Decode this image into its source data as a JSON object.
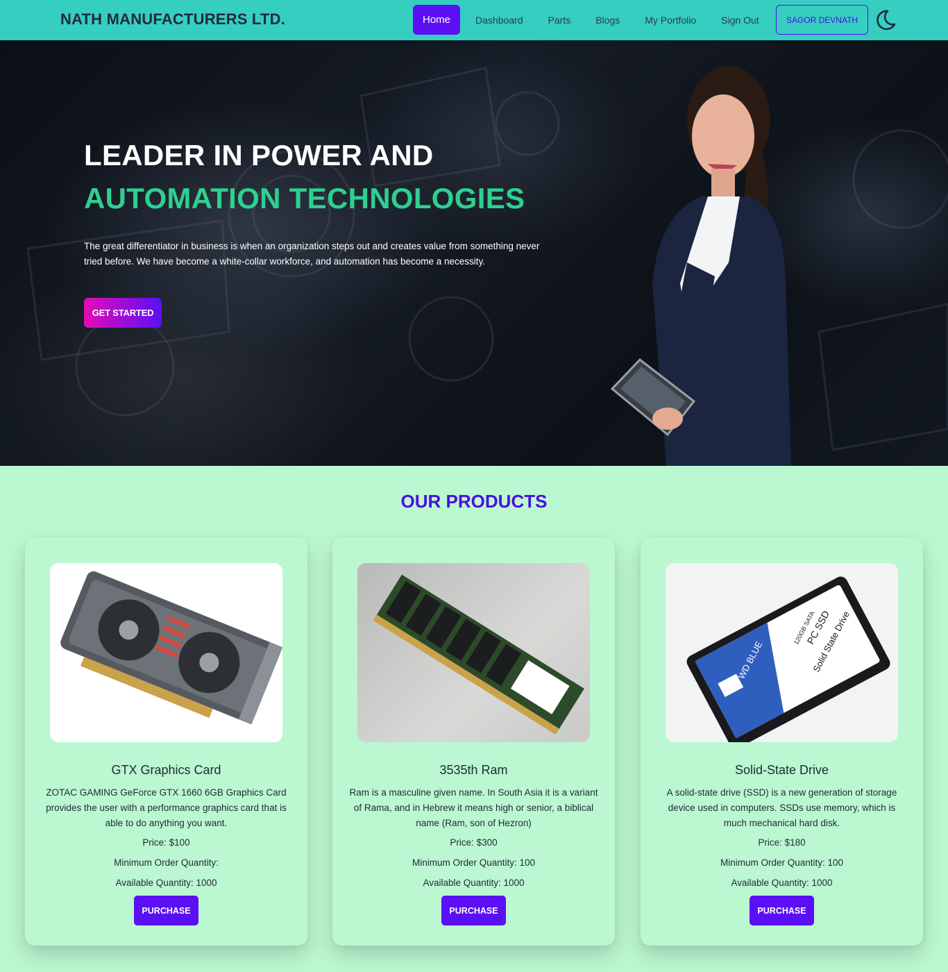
{
  "brand": "NATH MANUFACTURERS LTD.",
  "nav": {
    "items": [
      {
        "label": "Home",
        "active": true
      },
      {
        "label": "Dashboard"
      },
      {
        "label": "Parts"
      },
      {
        "label": "Blogs"
      },
      {
        "label": "My Portfolio"
      },
      {
        "label": "Sign Out"
      }
    ],
    "user": "SAGOR DEVNATH",
    "theme_icon": "moon-icon"
  },
  "hero": {
    "title_line1": "LEADER IN POWER AND",
    "title_line2": "AUTOMATION TECHNOLOGIES",
    "text": "The great differentiator in business is when an organization steps out and creates value from something never tried before. We have become a white-collar workforce, and automation has become a necessity.",
    "cta": "GET STARTED"
  },
  "products": {
    "title": "OUR PRODUCTS",
    "items": [
      {
        "name": "GTX Graphics Card",
        "description": "ZOTAC GAMING GeForce GTX 1660 6GB Graphics Card provides the user with a performance graphics card that is able to do anything you want.",
        "price": "Price: $100",
        "min_order": "Minimum Order Quantity:",
        "available": "Available Quantity: 1000",
        "button": "PURCHASE"
      },
      {
        "name": "3535th Ram",
        "description": "Ram is a masculine given name. In South Asia it is a variant of Rama, and in Hebrew it means high or senior, a biblical name (Ram, son of Hezron)",
        "price": "Price: $300",
        "min_order": "Minimum Order Quantity: 100",
        "available": "Available Quantity: 1000",
        "button": "PURCHASE"
      },
      {
        "name": "Solid-State Drive",
        "description": "A solid-state drive (SSD) is a new generation of storage device used in computers. SSDs use memory, which is much mechanical hard disk.",
        "price": "Price: $180",
        "min_order": "Minimum Order Quantity: 100",
        "available": "Available Quantity: 1000",
        "button": "PURCHASE",
        "label_text": [
          "WD BLUE",
          "120GB SATA",
          "PC SSD",
          "Solid State Drive"
        ]
      }
    ]
  },
  "colors": {
    "navbar": "#35cec1",
    "accent": "#5b0ff5",
    "hero_green": "#2ed08f",
    "page_bg": "#bbf7d0"
  }
}
